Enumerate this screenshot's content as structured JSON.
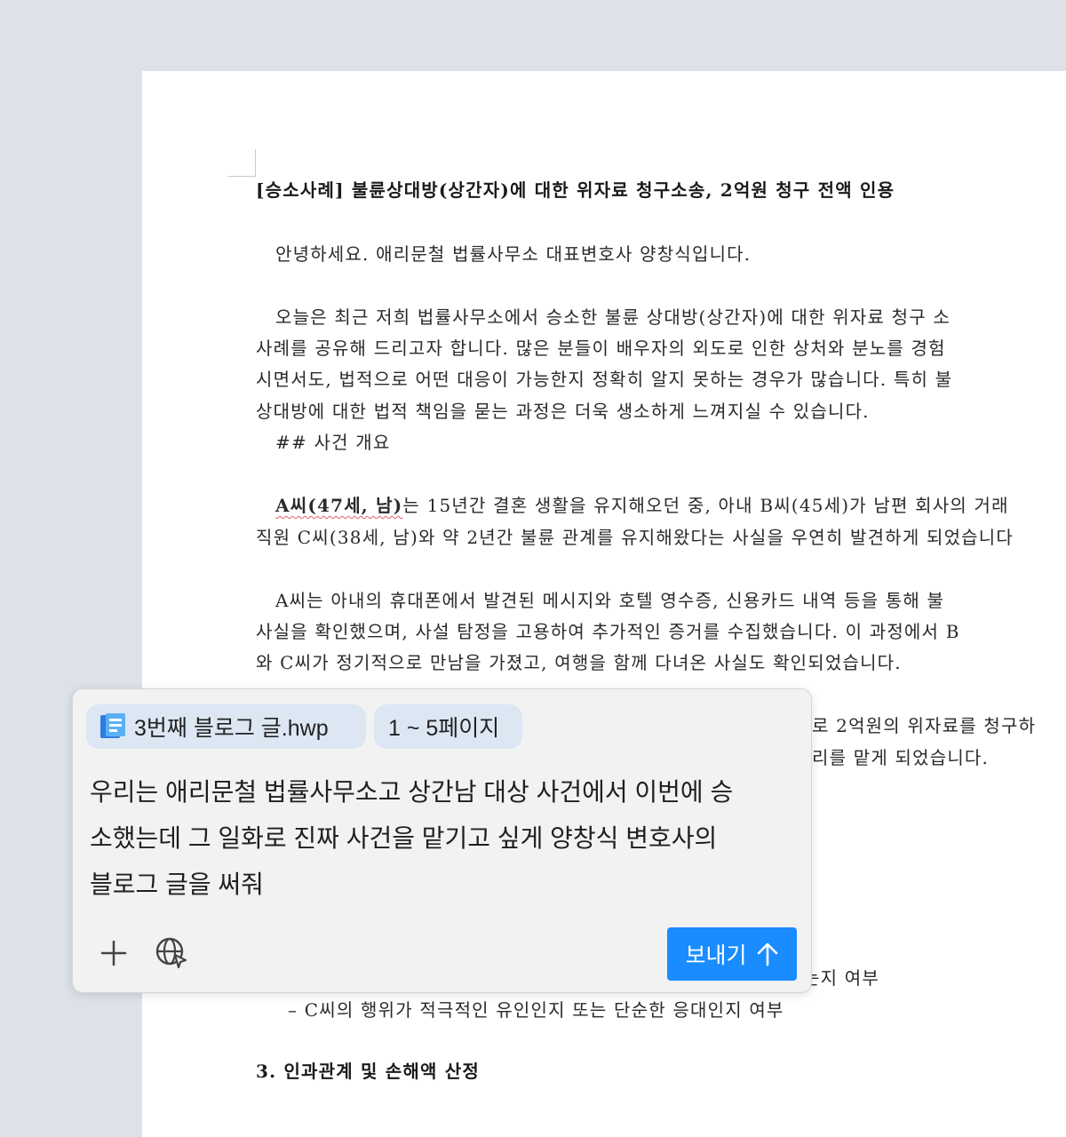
{
  "document": {
    "title": "[승소사례] 불륜상대방(상간자)에 대한 위자료 청구소송, 2억원 청구 전액 인용",
    "greeting": "안녕하세요. 애리문철 법률사무소 대표변호사 양창식입니다.",
    "para1": [
      "오늘은 최근 저희 법률사무소에서 승소한 불륜 상대방(상간자)에 대한 위자료 청구 소",
      "사례를 공유해 드리고자 합니다. 많은 분들이 배우자의 외도로 인한 상처와 분노를 경험",
      "시면서도, 법적으로 어떤 대응이 가능한지 정확히 알지 못하는 경우가 많습니다. 특히 불",
      "상대방에 대한 법적 책임을 묻는 과정은 더욱 생소하게 느껴지실 수 있습니다."
    ],
    "heading_overview": "## 사건 개요",
    "para2_bold": "A씨(47세, 남)",
    "para2_rest": "는 15년간 결혼 생활을 유지해오던 중, 아내 B씨(45세)가 남편 회사의 거래",
    "para2_line2": "직원 C씨(38세, 남)와 약 2년간 불륜 관계를 유지해왔다는 사실을 우연히 발견하게 되었습니다",
    "para3": [
      "A씨는 아내의 휴대폰에서 발견된 메시지와 호텔 영수증, 신용카드 내역 등을 통해 불",
      "사실을 확인했으며, 사설 탐정을 고용하여 추가적인 증거를 수집했습니다. 이 과정에서 B",
      "와 C씨가 정기적으로 만남을 가졌고, 여행을 함께 다녀온 사실도 확인되었습니다."
    ],
    "partial_right_1": "로 2억원의 위자료를 청구하",
    "partial_right_2": "리를 맡게 되었습니다.",
    "partial_right_3": "는지 여부",
    "bullet_line": "– C씨의 행위가 적극적인 유인인지 또는 단순한 응대인지 여부",
    "cut_heading": "3. 인과관계 및 손해액 산정"
  },
  "chat": {
    "file_chip": "3번째 블로그 글.hwp",
    "file_icon": "hwp-file-icon",
    "pages_chip": "1 ~ 5페이지",
    "prompt_lines": [
      "우리는 애리문철 법률사무소고 상간남 대상 사건에서 이번에 승",
      "소했는데 그 일화로 진짜 사건을 맡기고 싶게 양창식 변호사의",
      "블로그 글을 써줘"
    ],
    "send_label": "보내기",
    "plus_icon": "plus-icon",
    "globe_icon": "globe-cursor-icon",
    "send_icon": "arrow-up-icon",
    "accent_color": "#1a8cff",
    "chip_color": "#dde7f3"
  }
}
